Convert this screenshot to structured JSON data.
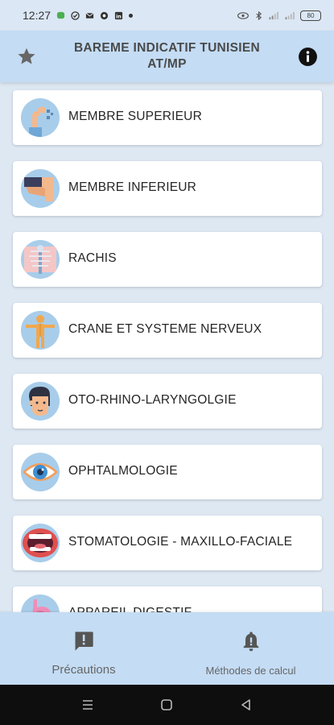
{
  "status_bar": {
    "time": "12:27",
    "battery": "80"
  },
  "app_bar": {
    "title_line1": "BAREME INDICATIF TUNISIEN",
    "title_line2": "AT/MP",
    "left_icon": "star-icon",
    "right_icon": "info-icon"
  },
  "categories": [
    {
      "label": "MEMBRE SUPERIEUR",
      "icon": "arm-icon"
    },
    {
      "label": "MEMBRE INFERIEUR",
      "icon": "leg-icon"
    },
    {
      "label": "RACHIS",
      "icon": "spine-icon"
    },
    {
      "label": "CRANE ET SYSTEME NERVEUX",
      "icon": "body-icon"
    },
    {
      "label": "OTO-RHINO-LARYNGOLGIE",
      "icon": "head-icon"
    },
    {
      "label": "OPHTALMOLOGIE",
      "icon": "eye-icon"
    },
    {
      "label": "STOMATOLOGIE - MAXILLO-FACIALE",
      "icon": "mouth-icon"
    },
    {
      "label": "APPAREIL DIGESTIF",
      "icon": "stomach-icon"
    }
  ],
  "bottom_nav": {
    "left_label": "Précautions",
    "left_icon": "alert-message-icon",
    "right_label": "Méthodes de calcul",
    "right_icon": "bell-alert-icon"
  },
  "colors": {
    "app_bar": "#c4dcf4",
    "background": "#dde8f3",
    "card": "#ffffff",
    "icon_bg": "#a8cdea"
  }
}
